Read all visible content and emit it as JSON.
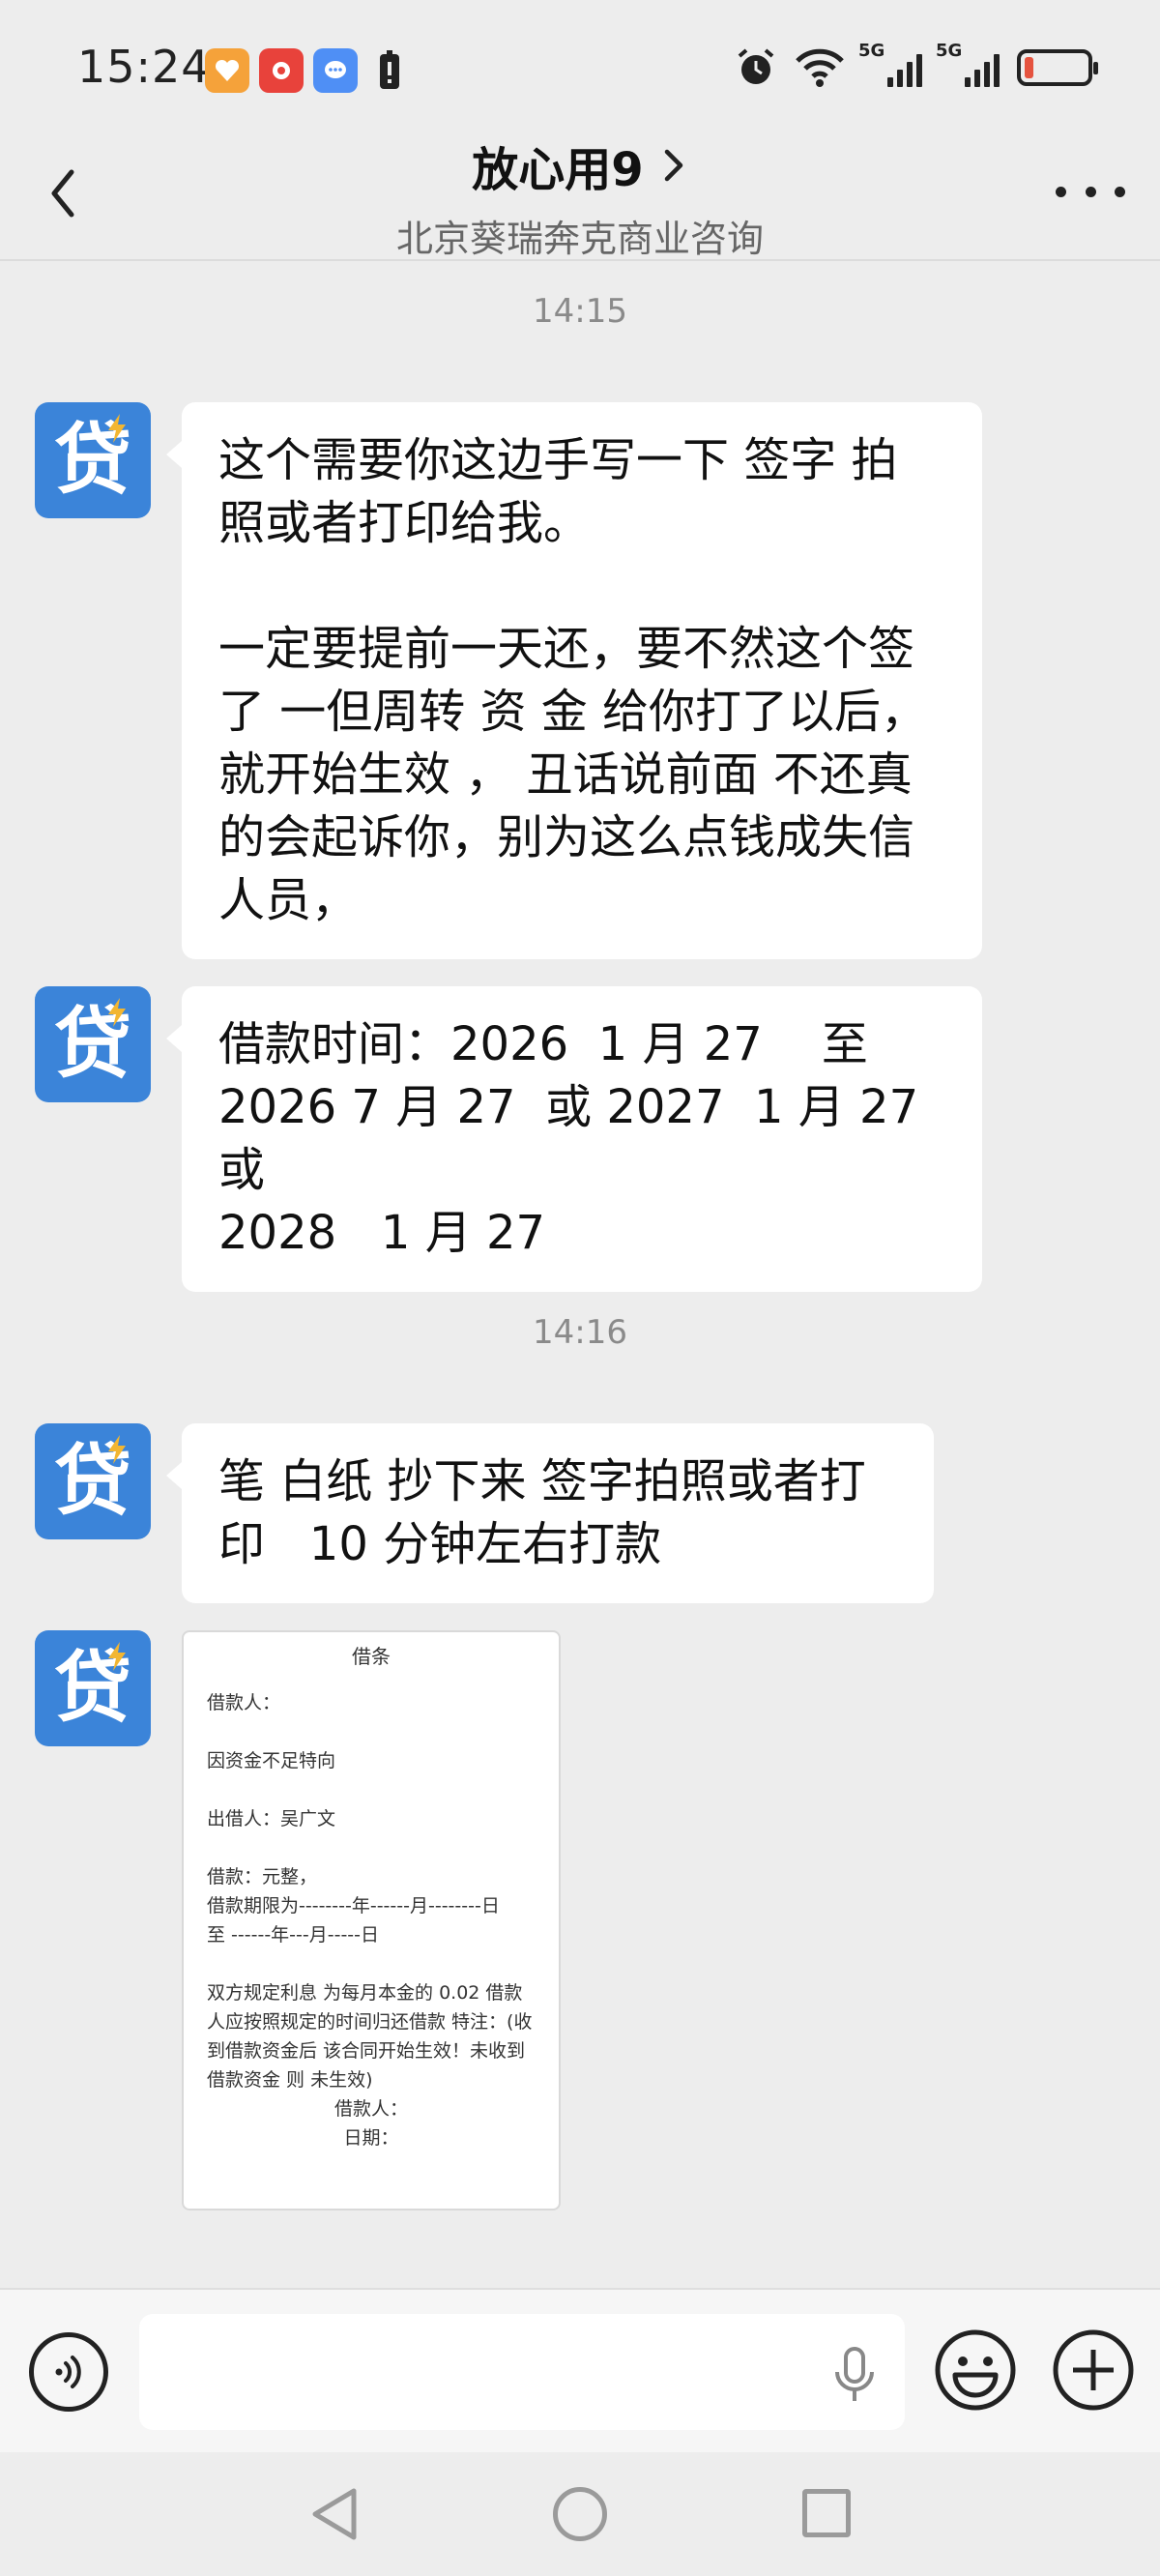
{
  "status_bar": {
    "time": "15:24",
    "network_label_1": "5G",
    "network_label_2": "5G"
  },
  "header": {
    "title": "放心用9",
    "subtitle": "北京葵瑞奔克商业咨询"
  },
  "avatar": {
    "glyph": "贷",
    "color": "#3b84d9"
  },
  "messages": {
    "time_1": "14:15",
    "msg_1": "这个需要你这边手写一下 签字 拍\n照或者打印给我。\n\n一定要提前一天还，要不然这个签\n了 一但周转 资 金 给你打了以后，\n就开始生效 ， 丑话说前面 不还真\n的会起诉你，别为这么点钱成失信\n人员，",
    "msg_2": "借款时间：2026  1 月 27    至\n2026 7 月 27  或 2027  1 月 27  或\n2028   1 月 27",
    "time_2": "14:16",
    "msg_3": "笔 白纸 抄下来 签字拍照或者打\n印   10 分钟左右打款"
  },
  "document": {
    "title": "借条",
    "borrower_line": "借款人：",
    "reason_line": "因资金不足特向",
    "lender_line": "出借人：吴广文",
    "amount_line": "借款：元整，",
    "term_line_1": "借款期限为--------年------月--------日",
    "term_line_2": "至     ------年---月-----日",
    "terms_text": "双方规定利息 为每月本金的 0.02 借款人应按照规定的时间归还借款  特注：(收到借款资金后 该合同开始生效！未收到借款资金 则 未生效)",
    "sign_borrower": "借款人：",
    "sign_date": "日期："
  },
  "colors": {
    "accent": "#3b84d9",
    "background": "#ededed",
    "bubble": "#ffffff"
  }
}
